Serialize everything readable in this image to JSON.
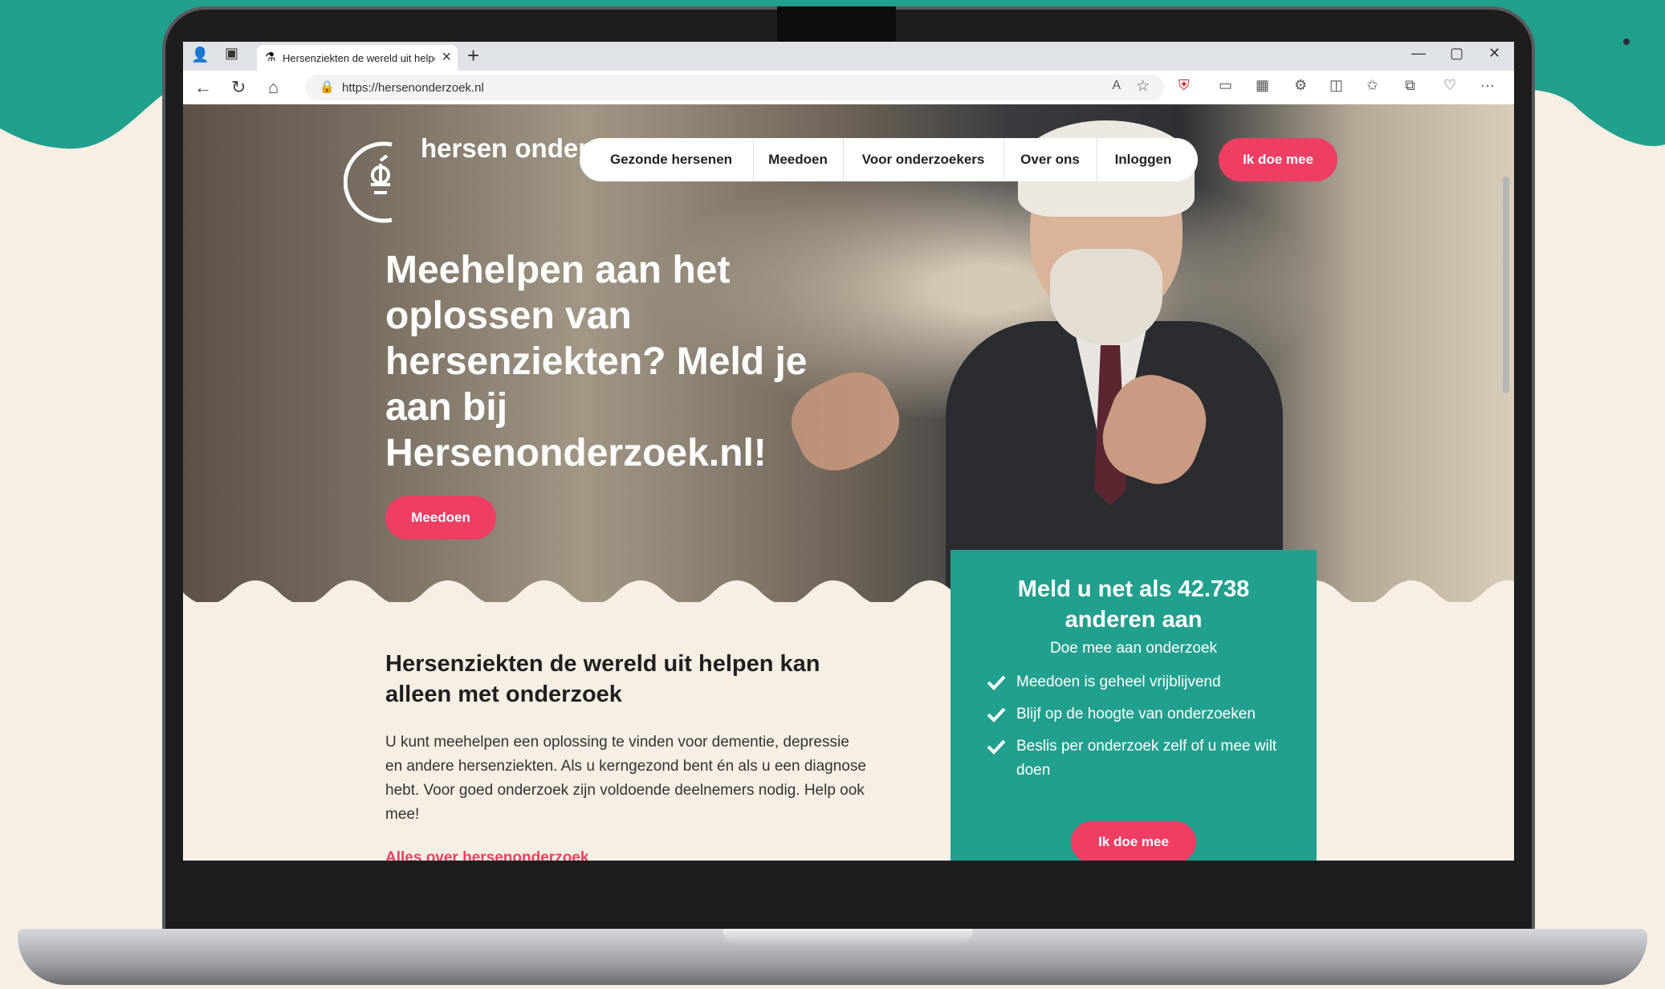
{
  "browser": {
    "tab_title": "Hersenziekten de wereld uit helpen",
    "url": "https://hersenonderzoek.nl",
    "new_tab": "+",
    "tab_close": "×"
  },
  "site": {
    "logo": "hersen onderzoek nl",
    "nav": [
      "Gezonde hersenen",
      "Meedoen",
      "Voor onderzoekers",
      "Over ons",
      "Inloggen"
    ],
    "cta_header": "Ik doe mee",
    "headline": "Meehelpen aan het oplossen van hersenziekten? Meld je aan bij Hersenonderzoek.nl!",
    "hero_button": "Meedoen",
    "section_title": "Hersenziekten de wereld uit helpen kan alleen met onderzoek",
    "section_text": "U kunt meehelpen een oplossing te vinden voor dementie, depressie en andere hersenziekten. Als u kerngezond bent én als u een diagnose hebt. Voor goed onderzoek zijn voldoende deelnemers nodig. Help ook mee!",
    "section_link": "Alles over hersenonderzoek"
  },
  "card": {
    "title_prefix": "Meld u net als",
    "count": "42.738",
    "title_suffix": "anderen aan",
    "subtitle": "Doe mee aan onderzoek",
    "bullets": [
      "Meedoen is geheel vrijblijvend",
      "Blijf op de hoogte van onderzoeken",
      "Beslis per onderzoek zelf of u mee wilt doen"
    ],
    "button": "Ik doe mee"
  },
  "colors": {
    "teal": "#21a08e",
    "pink": "#ee3e64",
    "cream": "#f8efe4"
  }
}
